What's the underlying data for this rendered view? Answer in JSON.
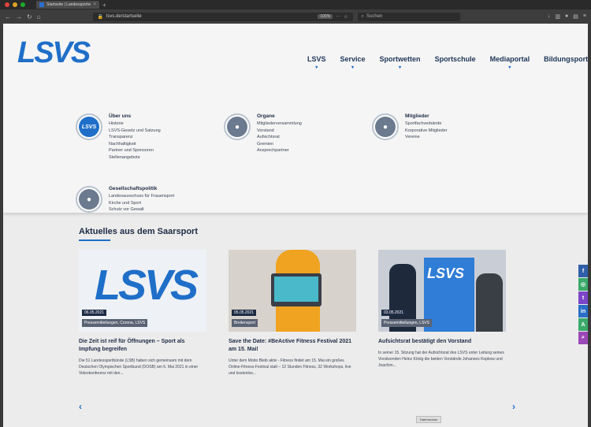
{
  "browser": {
    "tab_title": "Startseite | Landessportverband f...",
    "tab_close": "×",
    "new_tab": "+",
    "url": "lsvs.de/startseite",
    "zoom": "100%",
    "search_placeholder": "Suchen"
  },
  "site": {
    "logo_text": "LSVS",
    "nav": [
      {
        "label": "LSVS"
      },
      {
        "label": "Service"
      },
      {
        "label": "Sportwetten"
      },
      {
        "label": "Sportschule"
      },
      {
        "label": "Mediaportal"
      },
      {
        "label": "Bildungsportal"
      }
    ],
    "mega": [
      {
        "badge": "LSVS",
        "title": "Über uns",
        "items": [
          "Historie",
          "LSVS-Gesetz und Satzung",
          "Transparenz",
          "Nachhaltigkeit",
          "Partner und Sponsoren",
          "Stellenangebote"
        ]
      },
      {
        "badge": "●",
        "title": "Organe",
        "items": [
          "Mitgliederversammlung",
          "Vorstand",
          "Aufsichtsrat",
          "Gremien",
          "Ansprechpartner"
        ]
      },
      {
        "badge": "●",
        "title": "Mitglieder",
        "items": [
          "Sportfachverbände",
          "Korporative Mitglieder",
          "Vereine"
        ]
      },
      {
        "badge": "●",
        "title": "Gesellschaftspolitik",
        "items": [
          "Landesausschuss für Frauensport",
          "Kirche und Sport",
          "Schutz vor Gewalt"
        ]
      }
    ],
    "news_section_title": "Aktuelles aus dem Saarsport",
    "news": [
      {
        "date": "06.05.2021",
        "caption": "Pressemitteilungen, Corona, LSVS",
        "title": "Die Zeit ist reif für Öffnungen – Sport als Impfung begreifen",
        "desc": "Die 51 Landessportbünde (LSB) haben sich gemeinsam mit dem Deutschen Olympischen Sportbund (DOSB) am 6. Mai 2021 in einer Videokonferenz mit den..."
      },
      {
        "date": "05.05.2021",
        "caption": "Breitensport",
        "title": "Save the Date: #BeActive Fitness Festival 2021 am 15. Mai!",
        "desc": "Unter dem Motto Bleib aktiv - Fitness findet am 15. Mai ein großes Online-Fitness-Festival statt – 12 Stunden Fitness, 32 Workshops, live und kostenlos..."
      },
      {
        "date": "03.05.2021",
        "caption": "Pressemitteilungen, LSVS",
        "title": "Aufsichtsrat bestätigt den Vorstand",
        "desc": "In seiner 15. Sitzung hat der Aufsichtsrat des LSVS unter Leitung seines Vorsitzenden Heinz König die beiden Vorstände Johannes Kopkow und Joachim..."
      }
    ],
    "prev_arrow": "‹",
    "next_arrow": "›",
    "cookie_label": "Datenschutz",
    "social": [
      {
        "icon": "f",
        "color": "#2f5fa8"
      },
      {
        "icon": "◎",
        "color": "#3aa96b"
      },
      {
        "icon": "t",
        "color": "#7b45c9"
      },
      {
        "icon": "in",
        "color": "#2a6ec6"
      },
      {
        "icon": "A",
        "color": "#3aa96b"
      },
      {
        "icon": "⌕",
        "color": "#9b49b8"
      }
    ]
  }
}
